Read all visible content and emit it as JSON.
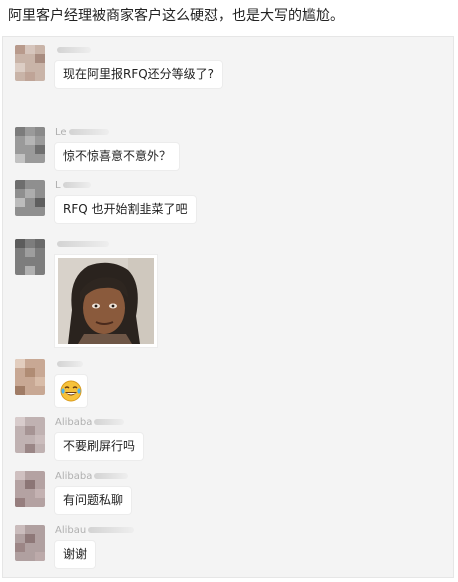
{
  "headline": "阿里客户经理被商家客户这么硬怼，也是大写的尴尬。",
  "chat": {
    "messages": [
      {
        "sender": "",
        "text": "现在阿里报RFQ还分等级了?"
      },
      {
        "sender": "Le",
        "text": "惊不惊喜意不意外？"
      },
      {
        "sender": "L",
        "text": "RFQ 也开始割韭菜了吧"
      },
      {
        "sender": "",
        "image": "grimy-man-meme-photo"
      },
      {
        "sender": "",
        "sticker": "laughing-crying-emoji"
      },
      {
        "sender": "Alibaba",
        "text": "不要刷屏行吗"
      },
      {
        "sender": "Alibaba",
        "text": "有问题私聊"
      },
      {
        "sender": "Alibau",
        "text": "谢谢"
      }
    ]
  },
  "colors": {
    "panel_background": "#f4f4f4",
    "bubble_background": "#ffffff",
    "sender_name": "#b0b0b0",
    "text": "#222222"
  }
}
